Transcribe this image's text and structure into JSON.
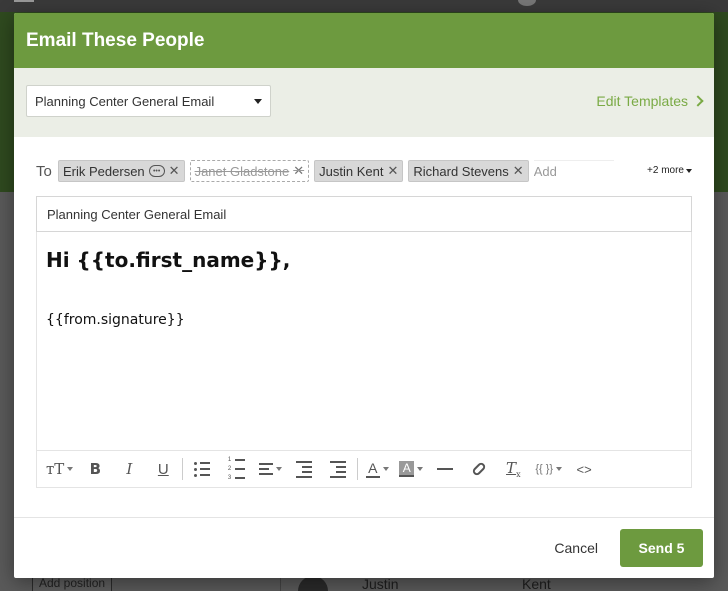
{
  "background": {
    "add_position_label": "Add position",
    "row_first_name": "Justin",
    "row_last_name": "Kent"
  },
  "modal": {
    "title": "Email These People",
    "template_select": {
      "value": "Planning Center General Email"
    },
    "edit_templates_label": "Edit Templates",
    "to_label": "To",
    "recipients": [
      {
        "name": "Erik Pedersen",
        "has_comment": true,
        "removed": false
      },
      {
        "name": "Janet Gladstone",
        "has_comment": false,
        "removed": true
      },
      {
        "name": "Justin Kent",
        "has_comment": false,
        "removed": false
      },
      {
        "name": "Richard Stevens",
        "has_comment": false,
        "removed": false
      }
    ],
    "add_placeholder": "Add",
    "more_label": "+2 more",
    "subject": "Planning Center General Email",
    "body": {
      "greeting": "Hi {{to.first_name}},",
      "signature": "{{from.signature}}"
    },
    "toolbar": {
      "font_size_label": "тT",
      "bold_label": "B",
      "italic_label": "I",
      "underline_label": "U",
      "font_color_label": "A",
      "bg_color_label": "A",
      "clear_format_label": "T",
      "clear_format_sub": "x",
      "merge_fields_label": "{{ }}",
      "code_label": "<>"
    },
    "cancel_label": "Cancel",
    "send_label": "Send 5"
  },
  "colors": {
    "brand_green": "#6d9a3f",
    "link_green": "#7aaa45",
    "template_bar_bg": "#ebeee6"
  }
}
